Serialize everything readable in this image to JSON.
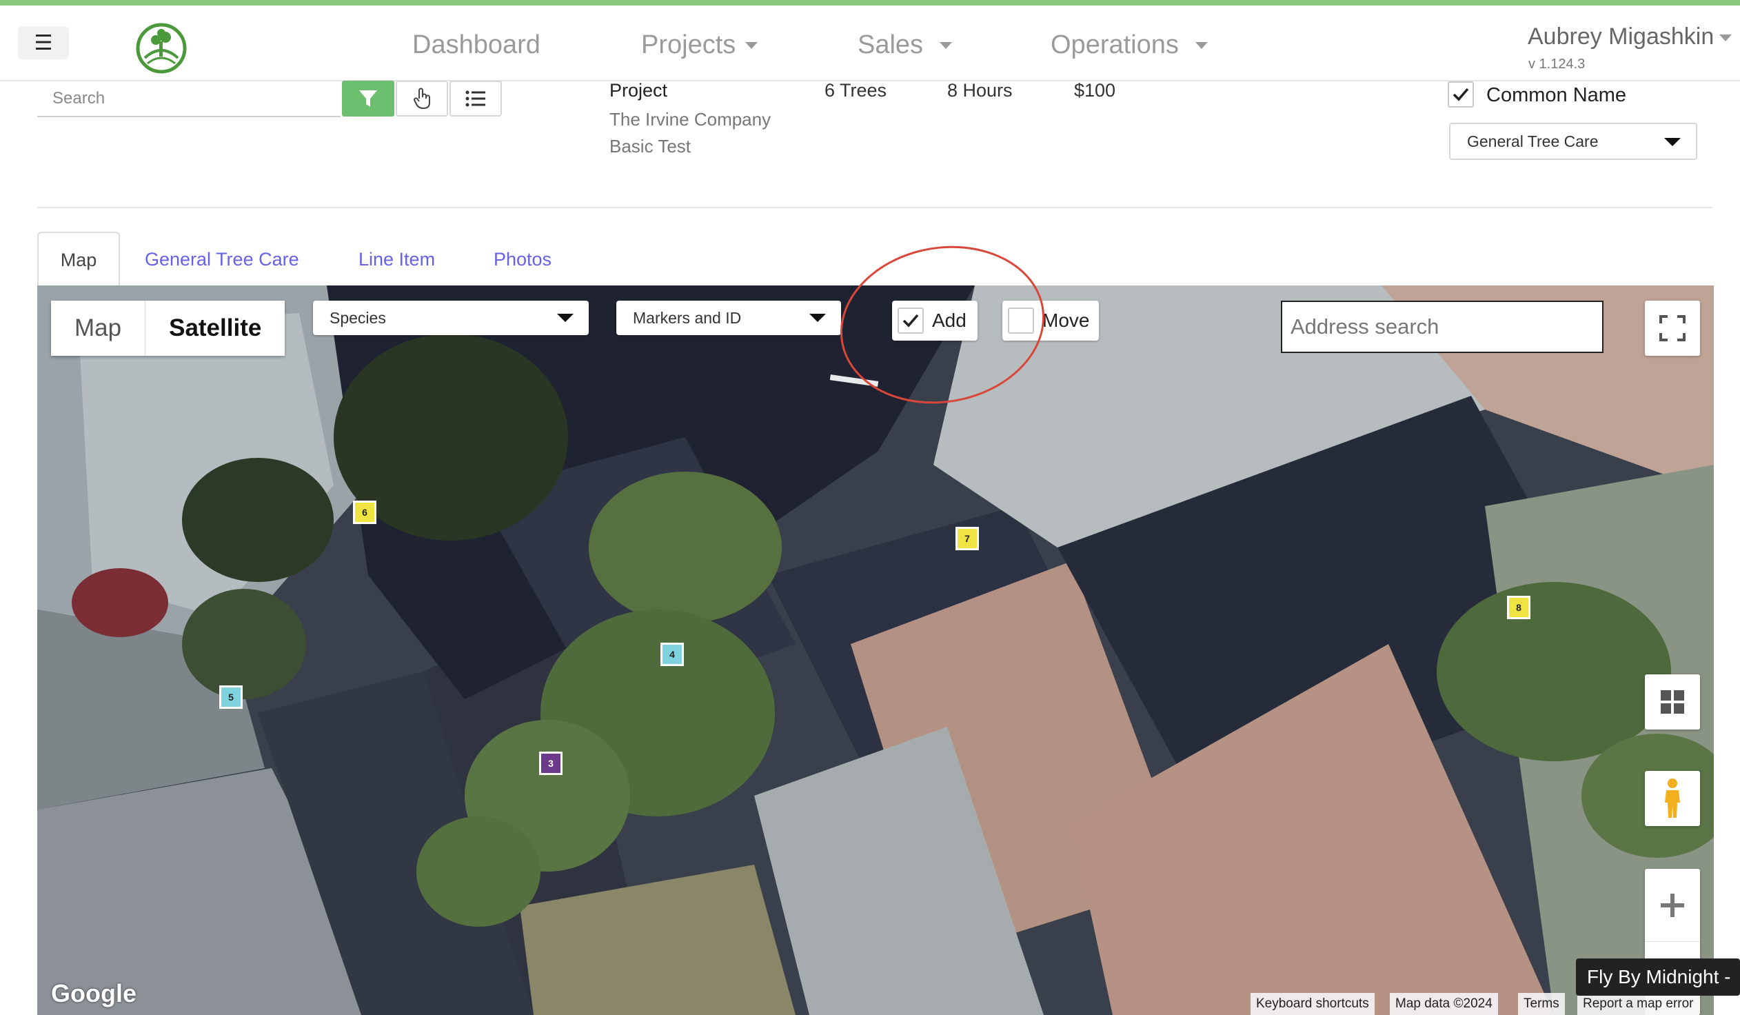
{
  "navbar": {
    "menu_icon": "hamburger-icon",
    "logo_icon": "tree-logo-icon",
    "items": [
      {
        "label": "Dashboard",
        "has_caret": false
      },
      {
        "label": "Projects",
        "has_caret": true
      },
      {
        "label": "Sales",
        "has_caret": true
      },
      {
        "label": "Operations",
        "has_caret": true
      }
    ],
    "user_name": "Aubrey Migashkin",
    "version": "v 1.124.3"
  },
  "toolbar": {
    "search_placeholder": "Search",
    "filter_icon": "filter-icon",
    "pointer_icon": "hand-pointer-icon",
    "list_icon": "list-icon"
  },
  "project": {
    "label": "Project",
    "name": "The Irvine Company Basic Test",
    "trees": "6 Trees",
    "hours": "8 Hours",
    "price": "$100"
  },
  "options": {
    "common_name_label": "Common Name",
    "common_name_checked": true,
    "care_select_value": "General Tree Care"
  },
  "tabs": [
    {
      "label": "Map",
      "active": true
    },
    {
      "label": "General Tree Care",
      "active": false
    },
    {
      "label": "Line Item",
      "active": false
    },
    {
      "label": "Photos",
      "active": false
    }
  ],
  "map": {
    "type_map": "Map",
    "type_satellite": "Satellite",
    "type_selected": "Satellite",
    "species_select": "Species",
    "markers_select": "Markers and ID",
    "add_label": "Add",
    "add_checked": true,
    "move_label": "Move",
    "move_checked": false,
    "address_placeholder": "Address search",
    "fullscreen_icon": "fullscreen-icon",
    "layers_icon": "layers-icon",
    "pegman_icon": "pegman-icon",
    "zoom_in_icon": "plus-icon",
    "zoom_out_icon": "minus-icon",
    "google_label": "Google",
    "attribution": {
      "shortcuts": "Keyboard shortcuts",
      "data": "Map data ©2024",
      "terms": "Terms",
      "report": "Report a map error"
    },
    "markers": [
      {
        "id": "6",
        "color": "#f0e442"
      },
      {
        "id": "7",
        "color": "#f0e442"
      },
      {
        "id": "8",
        "color": "#f0e442"
      },
      {
        "id": "4",
        "color": "#7fd3de"
      },
      {
        "id": "5",
        "color": "#7fd3de"
      },
      {
        "id": "3",
        "color": "#6b3a8a"
      }
    ]
  },
  "tooltip": "Fly By Midnight -",
  "colors": {
    "accent_green": "#6cbf6e",
    "tab_link": "#6761e6",
    "annotation_red": "#d9473b"
  }
}
